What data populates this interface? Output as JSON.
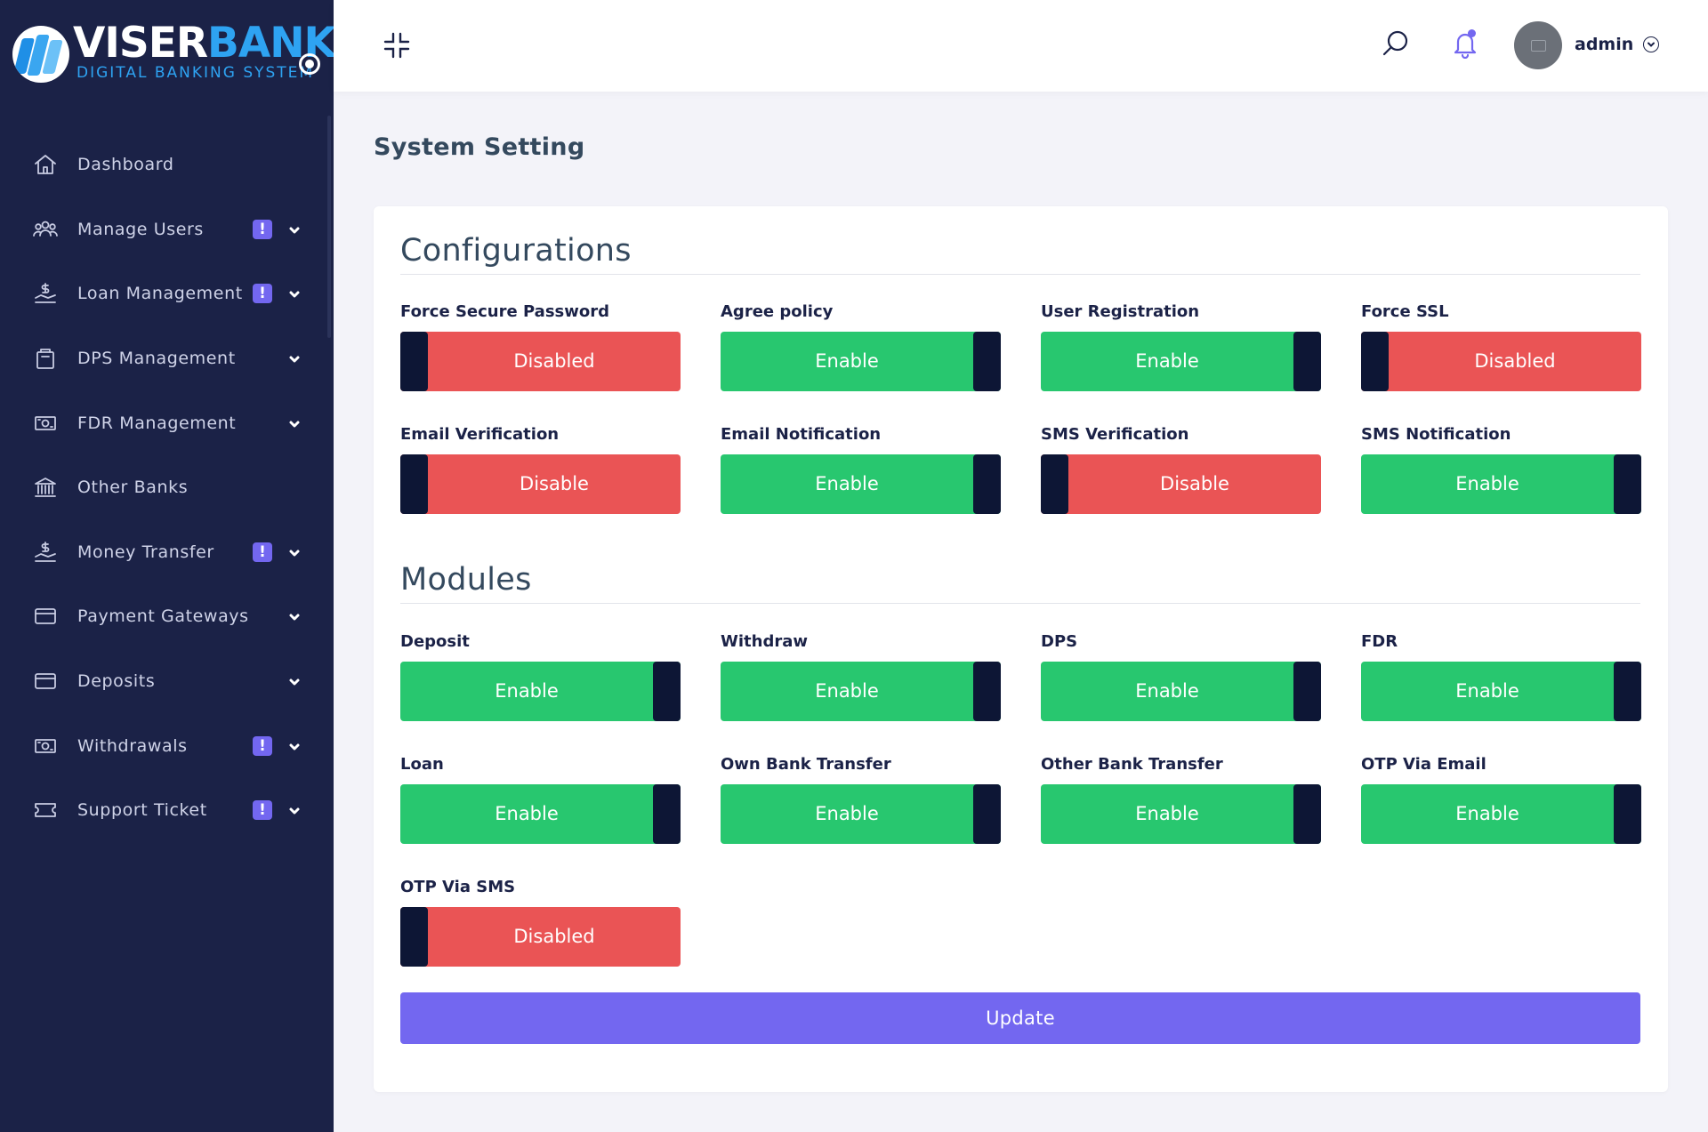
{
  "brand": {
    "name_part1": "VISER",
    "name_part2": "BANK",
    "tagline": "DIGITAL BANKING SYSTEM",
    "colors": {
      "sidebar": "#1b2247",
      "accent": "#2ea3f2"
    }
  },
  "sidebar": {
    "items": [
      {
        "label": "Dashboard",
        "icon": "home-icon",
        "badge": "",
        "chevron": false
      },
      {
        "label": "Manage Users",
        "icon": "users-icon",
        "badge": "!",
        "chevron": true
      },
      {
        "label": "Loan Management",
        "icon": "hand-coin-icon",
        "badge": "!",
        "chevron": true
      },
      {
        "label": "DPS Management",
        "icon": "briefcase-icon",
        "badge": "",
        "chevron": true
      },
      {
        "label": "FDR Management",
        "icon": "money-bill-icon",
        "badge": "",
        "chevron": true
      },
      {
        "label": "Other Banks",
        "icon": "bank-icon",
        "badge": "",
        "chevron": false
      },
      {
        "label": "Money Transfer",
        "icon": "hand-coin-icon",
        "badge": "!",
        "chevron": true
      },
      {
        "label": "Payment Gateways",
        "icon": "credit-card-icon",
        "badge": "",
        "chevron": true
      },
      {
        "label": "Deposits",
        "icon": "credit-card-icon",
        "badge": "",
        "chevron": true
      },
      {
        "label": "Withdrawals",
        "icon": "money-bill-icon",
        "badge": "!",
        "chevron": true
      },
      {
        "label": "Support Ticket",
        "icon": "ticket-icon",
        "badge": "!",
        "chevron": true
      }
    ]
  },
  "header": {
    "user_name": "admin",
    "icons": [
      "compress-icon",
      "search-icon",
      "bell-icon",
      "chevron-down-icon"
    ]
  },
  "page": {
    "title": "System Setting"
  },
  "configurations": {
    "title": "Configurations",
    "fields": [
      {
        "label": "Force Secure Password",
        "state": "off",
        "value": "Disabled"
      },
      {
        "label": "Agree policy",
        "state": "on",
        "value": "Enable"
      },
      {
        "label": "User Registration",
        "state": "on",
        "value": "Enable"
      },
      {
        "label": "Force SSL",
        "state": "off",
        "value": "Disabled"
      },
      {
        "label": "Email Verification",
        "state": "off",
        "value": "Disable"
      },
      {
        "label": "Email Notification",
        "state": "on",
        "value": "Enable"
      },
      {
        "label": "SMS Verification",
        "state": "off",
        "value": "Disable"
      },
      {
        "label": "SMS Notification",
        "state": "on",
        "value": "Enable"
      }
    ]
  },
  "modules": {
    "title": "Modules",
    "fields": [
      {
        "label": "Deposit",
        "state": "on",
        "value": "Enable"
      },
      {
        "label": "Withdraw",
        "state": "on",
        "value": "Enable"
      },
      {
        "label": "DPS",
        "state": "on",
        "value": "Enable"
      },
      {
        "label": "FDR",
        "state": "on",
        "value": "Enable"
      },
      {
        "label": "Loan",
        "state": "on",
        "value": "Enable"
      },
      {
        "label": "Own Bank Transfer",
        "state": "on",
        "value": "Enable"
      },
      {
        "label": "Other Bank Transfer",
        "state": "on",
        "value": "Enable"
      },
      {
        "label": "OTP Via Email",
        "state": "on",
        "value": "Enable"
      },
      {
        "label": "OTP Via SMS",
        "state": "off",
        "value": "Disabled"
      }
    ]
  },
  "actions": {
    "update_label": "Update"
  },
  "colors": {
    "enabled": "#28c76f",
    "disabled": "#ea5455",
    "primary": "#7367f0",
    "toggle_handle": "#0d1635"
  }
}
